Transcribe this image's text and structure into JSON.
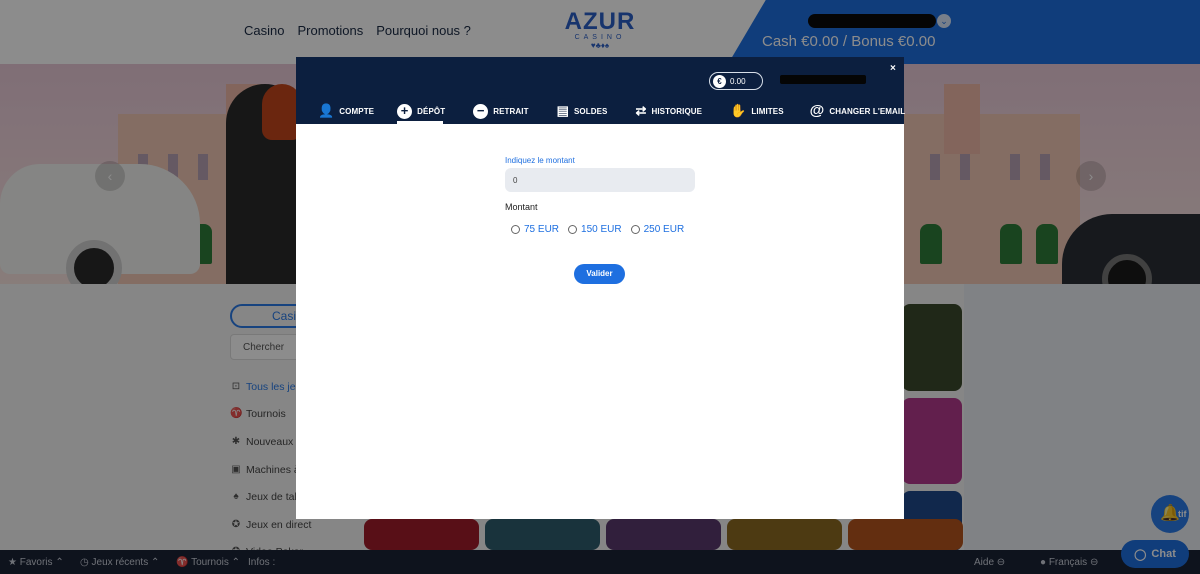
{
  "header": {
    "nav": [
      "Casino",
      "Promotions",
      "Pourquoi nous ?"
    ],
    "logo": {
      "title": "AZUR",
      "subtitle": "CASINO",
      "suits": "♥♣♦♠"
    },
    "account": {
      "cash_line": "Cash €0.00 / Bonus €0.00"
    }
  },
  "sidebar": {
    "category_pill": "Casi",
    "search_placeholder": "Chercher",
    "items": [
      {
        "label": "Tous les jeu",
        "icon": "list-icon"
      },
      {
        "label": "Tournois",
        "icon": "trophy-icon"
      },
      {
        "label": "Nouveaux",
        "icon": "new-icon"
      },
      {
        "label": "Machines à",
        "icon": "slot-icon"
      },
      {
        "label": "Jeux de tab",
        "icon": "cards-icon"
      },
      {
        "label": "Jeux en direct",
        "icon": "live-icon"
      },
      {
        "label": "Video Poker",
        "icon": "poker-icon"
      }
    ]
  },
  "bottombar": {
    "favoris": "Favoris",
    "recents": "Jeux récents",
    "tournois": "Tournois",
    "infos": "Infos :",
    "aide": "Aide",
    "langue": "Français"
  },
  "widgets": {
    "notif": "tif",
    "chat": "Chat"
  },
  "modal": {
    "close": "×",
    "balance": "0.00",
    "tabs": [
      {
        "label": "COMPTE",
        "icon": "user-icon"
      },
      {
        "label": "DÉPÔT",
        "icon": "plus-circle-icon"
      },
      {
        "label": "RETRAIT",
        "icon": "minus-circle-icon"
      },
      {
        "label": "SOLDES",
        "icon": "coins-icon"
      },
      {
        "label": "HISTORIQUE",
        "icon": "swap-arrows-icon"
      },
      {
        "label": "LIMITES",
        "icon": "hand-icon"
      },
      {
        "label": "CHANGER L'EMAIL",
        "icon": "at-icon"
      }
    ],
    "active_tab": "DÉPÔT",
    "deposit": {
      "amount_label": "Indiquez le montant",
      "amount_value": "0",
      "montant_title": "Montant",
      "options": [
        "75 EUR",
        "150 EUR",
        "250 EUR"
      ],
      "submit": "Valider"
    }
  },
  "colors": {
    "brand": "#1e6fe0",
    "modal_header": "#0c1f3f",
    "footer": "#1b2336"
  }
}
